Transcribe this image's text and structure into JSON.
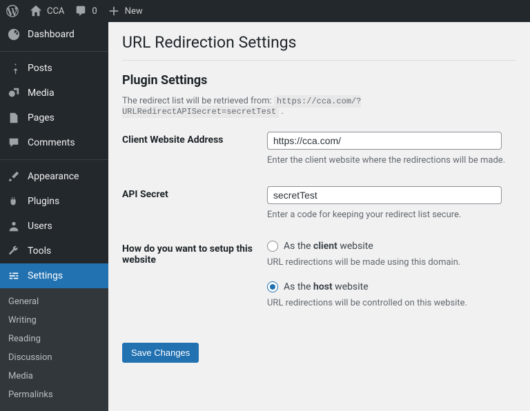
{
  "toolbar": {
    "site_name": "CCA",
    "comment_count": "0",
    "new_label": "New"
  },
  "sidebar": {
    "items": [
      {
        "label": "Dashboard"
      },
      {
        "label": "Posts"
      },
      {
        "label": "Media"
      },
      {
        "label": "Pages"
      },
      {
        "label": "Comments"
      },
      {
        "label": "Appearance"
      },
      {
        "label": "Plugins"
      },
      {
        "label": "Users"
      },
      {
        "label": "Tools"
      },
      {
        "label": "Settings"
      }
    ],
    "submenu": [
      {
        "label": "General"
      },
      {
        "label": "Writing"
      },
      {
        "label": "Reading"
      },
      {
        "label": "Discussion"
      },
      {
        "label": "Media"
      },
      {
        "label": "Permalinks"
      }
    ]
  },
  "page": {
    "title": "URL Redirection Settings",
    "section": "Plugin Settings",
    "lead_prefix": "The redirect list will be retrieved from: ",
    "lead_code": "https://cca.com/?URLRedirectAPISecret=secretTest",
    "lead_suffix": " .",
    "fields": {
      "client_address": {
        "label": "Client Website Address",
        "value": "https://cca.com/",
        "help": "Enter the client website where the redirections will be made."
      },
      "api_secret": {
        "label": "API Secret",
        "value": "secretTest",
        "help": "Enter a code for keeping your redirect list secure."
      },
      "setup_mode": {
        "label": "How do you want to setup this website",
        "client": {
          "prefix": "As the ",
          "bold": "client",
          "suffix": " website",
          "help": "URL redirections will be made using this domain."
        },
        "host": {
          "prefix": "As the ",
          "bold": "host",
          "suffix": " website",
          "help": "URL redirections will be controlled on this website."
        }
      }
    },
    "save_label": "Save Changes"
  }
}
